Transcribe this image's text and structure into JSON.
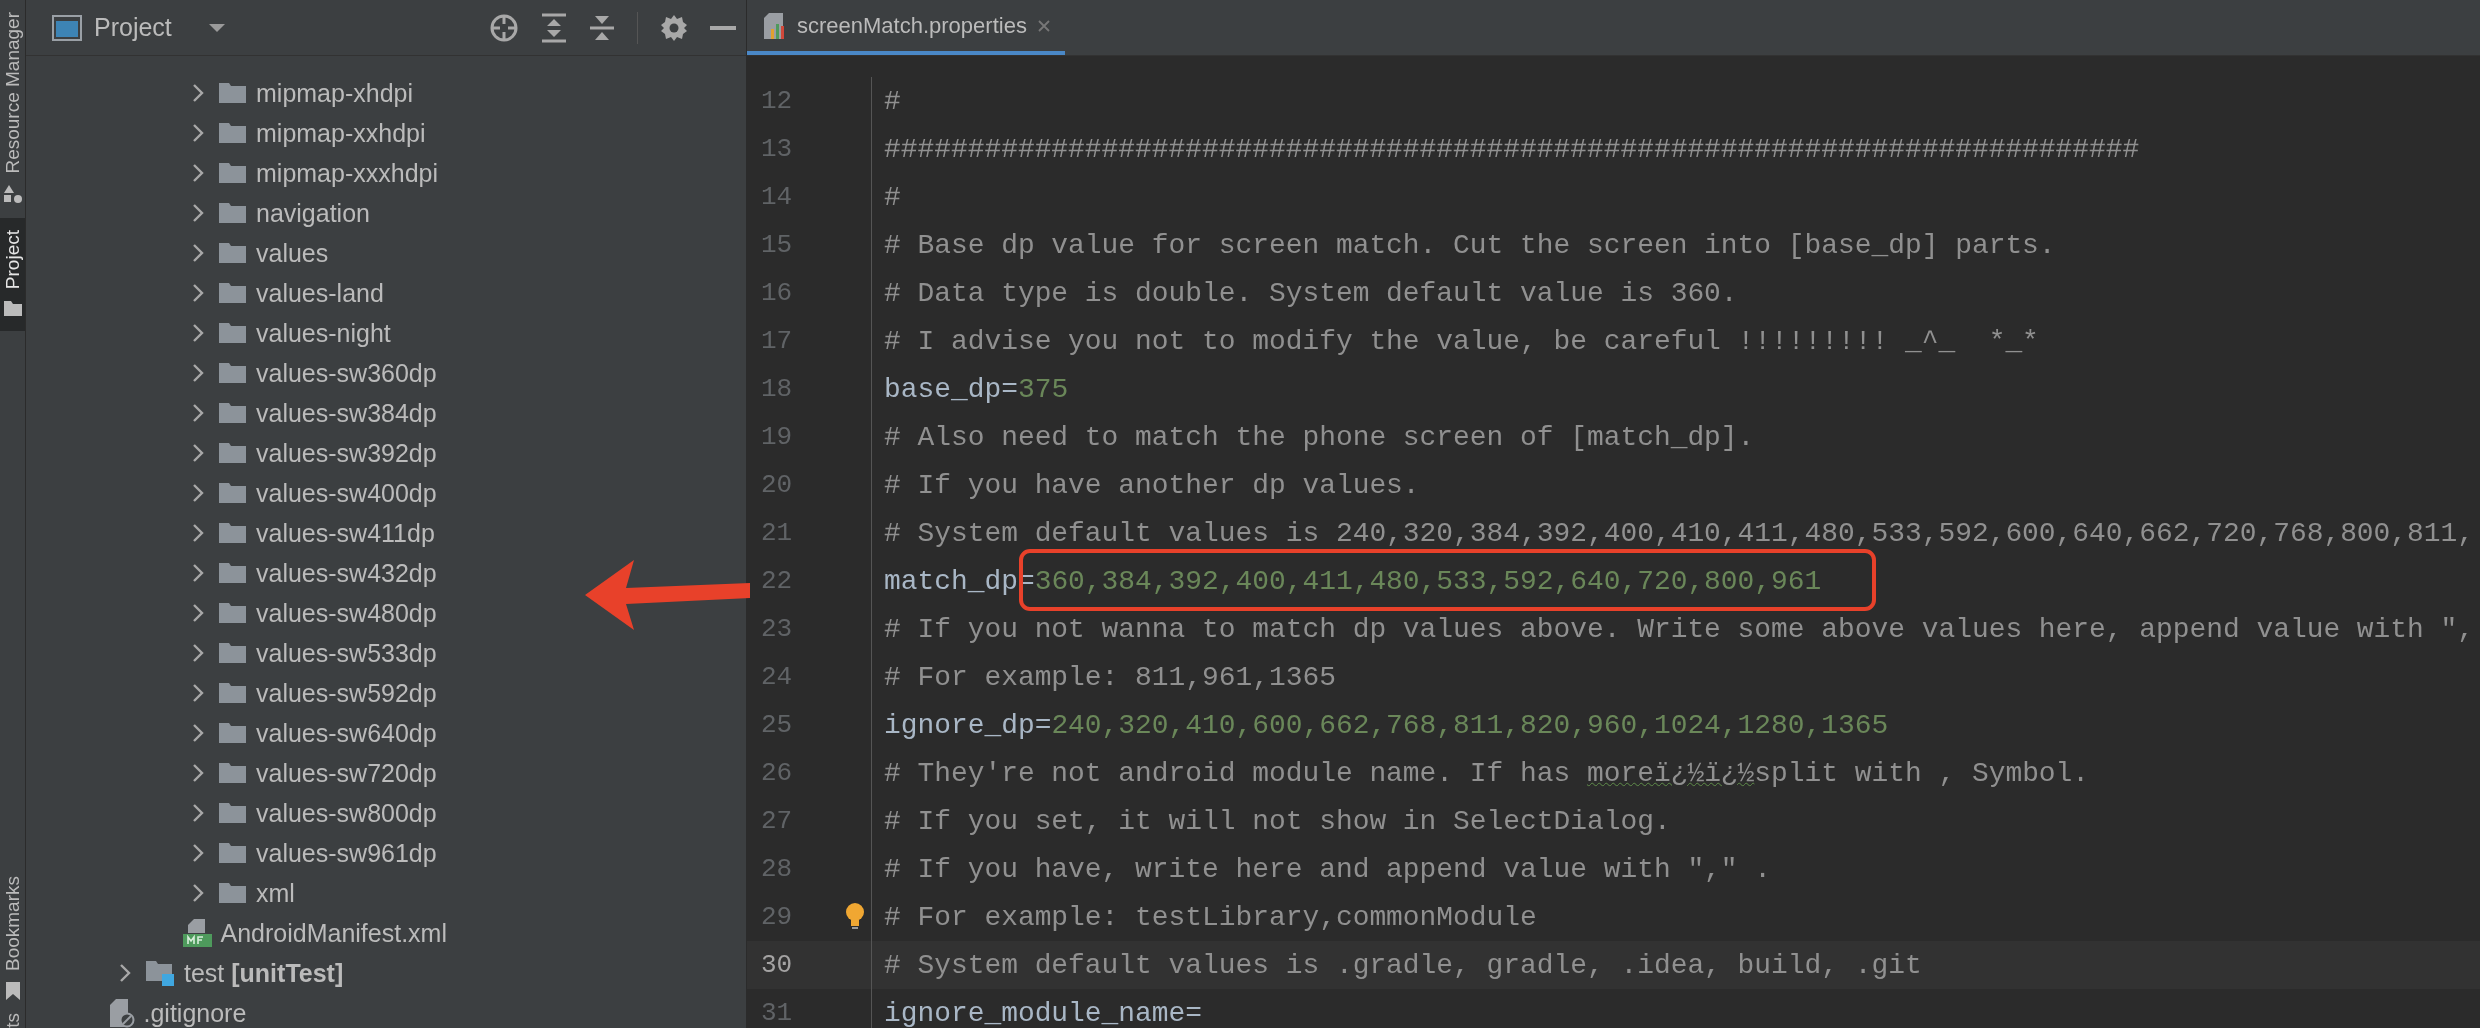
{
  "tool_strip": {
    "tabs": [
      {
        "label": "Resource Manager",
        "selected": false
      },
      {
        "label": "Project",
        "selected": true
      },
      {
        "label": "Bookmarks",
        "selected": false
      },
      {
        "label": "ts",
        "selected": false
      }
    ]
  },
  "project_panel": {
    "title": "Project",
    "tree": [
      {
        "children": [
          {
            "children": [
              {
                "children": [
                  {
                    "label": "mipmap-xhdpi",
                    "kind": "folder",
                    "expanded": false
                  },
                  {
                    "label": "mipmap-xxhdpi",
                    "kind": "folder",
                    "expanded": false
                  },
                  {
                    "label": "mipmap-xxxhdpi",
                    "kind": "folder",
                    "expanded": false
                  },
                  {
                    "label": "navigation",
                    "kind": "folder",
                    "expanded": false
                  },
                  {
                    "label": "values",
                    "kind": "folder",
                    "expanded": false
                  },
                  {
                    "label": "values-land",
                    "kind": "folder",
                    "expanded": false
                  },
                  {
                    "label": "values-night",
                    "kind": "folder",
                    "expanded": false
                  },
                  {
                    "label": "values-sw360dp",
                    "kind": "folder",
                    "expanded": false
                  },
                  {
                    "label": "values-sw384dp",
                    "kind": "folder",
                    "expanded": false
                  },
                  {
                    "label": "values-sw392dp",
                    "kind": "folder",
                    "expanded": false
                  },
                  {
                    "label": "values-sw400dp",
                    "kind": "folder",
                    "expanded": false
                  },
                  {
                    "label": "values-sw411dp",
                    "kind": "folder",
                    "expanded": false
                  },
                  {
                    "label": "values-sw432dp",
                    "kind": "folder",
                    "expanded": false
                  },
                  {
                    "label": "values-sw480dp",
                    "kind": "folder",
                    "expanded": false
                  },
                  {
                    "label": "values-sw533dp",
                    "kind": "folder",
                    "expanded": false
                  },
                  {
                    "label": "values-sw592dp",
                    "kind": "folder",
                    "expanded": false
                  },
                  {
                    "label": "values-sw640dp",
                    "kind": "folder",
                    "expanded": false
                  },
                  {
                    "label": "values-sw720dp",
                    "kind": "folder",
                    "expanded": false
                  },
                  {
                    "label": "values-sw800dp",
                    "kind": "folder",
                    "expanded": false
                  },
                  {
                    "label": "values-sw961dp",
                    "kind": "folder",
                    "expanded": false
                  },
                  {
                    "label": "xml",
                    "kind": "folder",
                    "expanded": false
                  }
                ]
              },
              {
                "label": "AndroidManifest.xml",
                "kind": "manifest"
              }
            ]
          },
          {
            "label": "test **[unitTest]**",
            "kind": "test-folder",
            "expanded": false
          }
        ]
      },
      {
        "label": ".gitignore",
        "kind": "ignore-file"
      }
    ]
  },
  "editor": {
    "tabs": [
      {
        "label": "screenMatch.properties",
        "selected": true
      }
    ],
    "lines": [
      {
        "number": "12",
        "current": false,
        "bulb": false,
        "segments": [
          {
            "kind": "comment",
            "text": "#"
          }
        ]
      },
      {
        "number": "13",
        "current": false,
        "bulb": false,
        "segments": [
          {
            "kind": "comment",
            "text": "###########################################################################"
          }
        ]
      },
      {
        "number": "14",
        "current": false,
        "bulb": false,
        "segments": [
          {
            "kind": "comment",
            "text": "#"
          }
        ]
      },
      {
        "number": "15",
        "current": false,
        "bulb": false,
        "segments": [
          {
            "kind": "comment",
            "text": "# Base dp value for screen match. Cut the screen into [base_dp] parts."
          }
        ]
      },
      {
        "number": "16",
        "current": false,
        "bulb": false,
        "segments": [
          {
            "kind": "comment",
            "text": "# Data type is double. System default value is 360."
          }
        ]
      },
      {
        "number": "17",
        "current": false,
        "bulb": false,
        "segments": [
          {
            "kind": "comment",
            "text": "# I advise you not to modify the value, be careful !!!!!!!!! _^_  *_*"
          }
        ]
      },
      {
        "number": "18",
        "current": false,
        "bulb": false,
        "segments": [
          {
            "kind": "key",
            "text": "base_dp="
          },
          {
            "kind": "value",
            "text": "375"
          }
        ]
      },
      {
        "number": "19",
        "current": false,
        "bulb": false,
        "segments": [
          {
            "kind": "comment",
            "text": "# Also need to match the phone screen of [match_dp]."
          }
        ]
      },
      {
        "number": "20",
        "current": false,
        "bulb": false,
        "segments": [
          {
            "kind": "comment",
            "text": "# If you have another dp values."
          }
        ]
      },
      {
        "number": "21",
        "current": false,
        "bulb": false,
        "segments": [
          {
            "kind": "comment",
            "text": "# System default values is 240,320,384,392,400,410,411,480,533,592,600,640,662,720,768,800,811,"
          }
        ]
      },
      {
        "number": "22",
        "current": false,
        "bulb": false,
        "segments": [
          {
            "kind": "key",
            "text": "match_dp="
          },
          {
            "kind": "value",
            "text": "360,384,392,400,411,480,533,592,640,720,800,961"
          }
        ]
      },
      {
        "number": "23",
        "current": false,
        "bulb": false,
        "segments": [
          {
            "kind": "comment",
            "text": "# If you not wanna to match dp values above. Write some above values here, append value with \","
          }
        ]
      },
      {
        "number": "24",
        "current": false,
        "bulb": false,
        "segments": [
          {
            "kind": "comment",
            "text": "# For example: 811,961,1365"
          }
        ]
      },
      {
        "number": "25",
        "current": false,
        "bulb": false,
        "segments": [
          {
            "kind": "key",
            "text": "ignore_dp="
          },
          {
            "kind": "value",
            "text": "240,320,410,600,662,768,811,820,960,1024,1280,1365"
          }
        ]
      },
      {
        "number": "26",
        "current": false,
        "bulb": false,
        "segments": [
          {
            "kind": "comment",
            "text": "# They're not android module name. If has "
          },
          {
            "kind": "typo",
            "text": "moreï¿½ï¿½"
          },
          {
            "kind": "comment",
            "text": "split with , Symbol."
          }
        ]
      },
      {
        "number": "27",
        "current": false,
        "bulb": false,
        "segments": [
          {
            "kind": "comment",
            "text": "# If you set, it will not show in SelectDialog."
          }
        ]
      },
      {
        "number": "28",
        "current": false,
        "bulb": false,
        "segments": [
          {
            "kind": "comment",
            "text": "# If you have, write here and append value with \",\" ."
          }
        ]
      },
      {
        "number": "29",
        "current": false,
        "bulb": true,
        "segments": [
          {
            "kind": "comment",
            "text": "# For example: testLibrary,commonModule"
          }
        ]
      },
      {
        "number": "30",
        "current": true,
        "bulb": false,
        "segments": [
          {
            "kind": "comment",
            "text": "# System default values is .gradle, gradle, .idea, build, .git"
          }
        ]
      },
      {
        "number": "31",
        "current": false,
        "bulb": false,
        "segments": [
          {
            "kind": "key",
            "text": "ignore_module_name="
          }
        ]
      }
    ]
  },
  "annotations": [
    {
      "kind": "box"
    },
    {
      "kind": "arrow"
    }
  ]
}
